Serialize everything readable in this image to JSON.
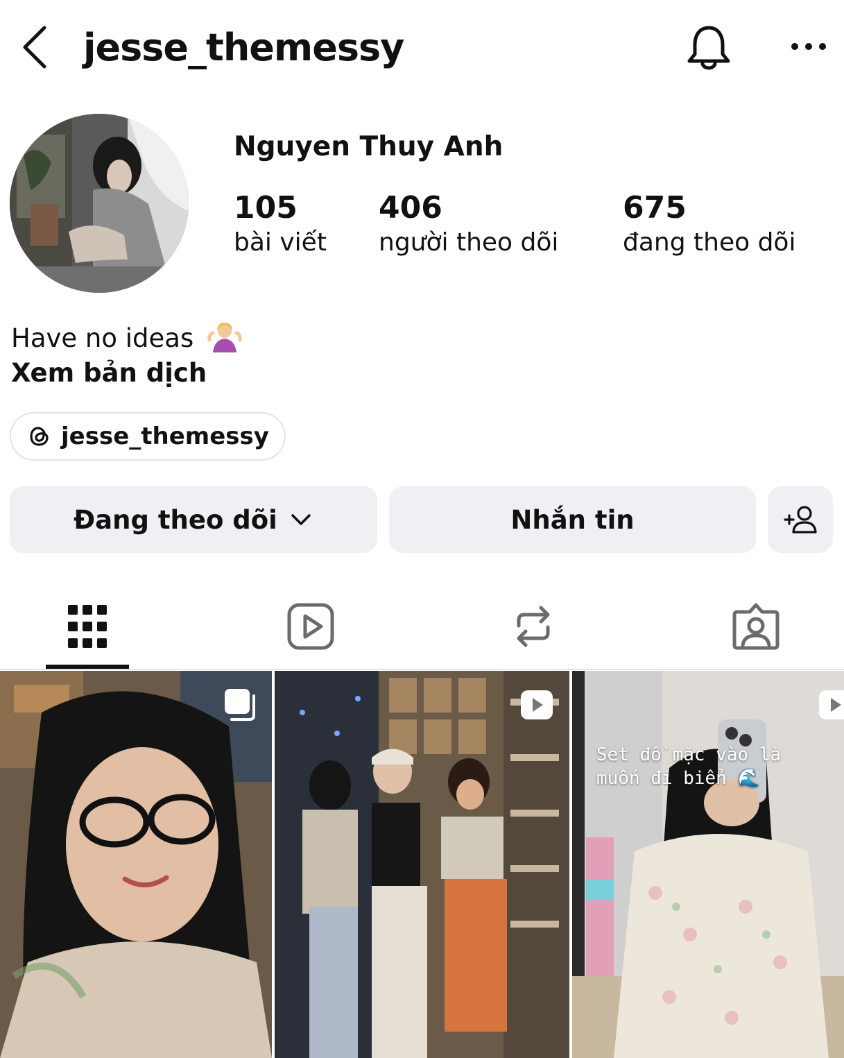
{
  "header": {
    "username": "jesse_themessy",
    "back_icon": "chevron-left-icon",
    "notification_icon": "bell-icon",
    "more_icon": "more-horizontal-icon"
  },
  "profile": {
    "display_name": "Nguyen Thuy Anh",
    "stats": [
      {
        "value": "105",
        "label": "bài viết"
      },
      {
        "value": "406",
        "label": "người theo dõi"
      },
      {
        "value": "675",
        "label": "đang theo dõi"
      }
    ],
    "bio": "Have no ideas",
    "bio_emoji": "person-shrugging-emoji",
    "translate_label": "Xem bản dịch",
    "threads_handle": "jesse_themessy"
  },
  "actions": {
    "following_label": "Đang theo dõi",
    "message_label": "Nhắn tin",
    "add_user_icon": "add-person-icon"
  },
  "tabs": [
    {
      "name": "grid",
      "icon": "grid-icon",
      "active": true
    },
    {
      "name": "reels",
      "icon": "reels-icon",
      "active": false
    },
    {
      "name": "reposts",
      "icon": "repost-icon",
      "active": false
    },
    {
      "name": "tagged",
      "icon": "tagged-person-icon",
      "active": false
    }
  ],
  "posts": [
    {
      "type": "carousel",
      "badge_icon": "carousel-icon"
    },
    {
      "type": "reel",
      "badge_icon": "play-icon"
    },
    {
      "type": "reel",
      "badge_icon": "play-icon",
      "caption": "Set đồ mặc vào là\nmuốn đi biển 🌊"
    }
  ],
  "colors": {
    "button_bg": "#efeff4",
    "text": "#111111",
    "divider": "#e5e5e5"
  }
}
